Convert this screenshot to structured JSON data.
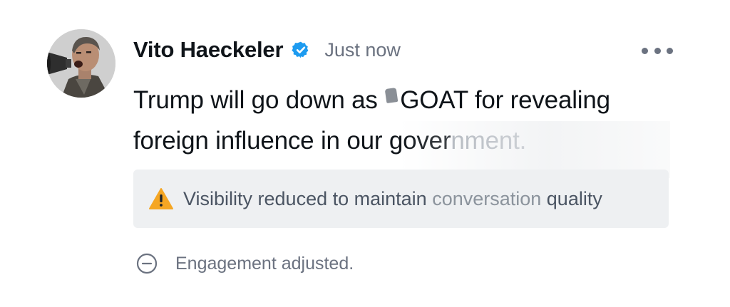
{
  "post": {
    "author": {
      "name": "Vito Haeckeler",
      "verified": true,
      "verified_color": "#1d9bf0"
    },
    "timestamp": "Just now",
    "more_icon": "more-horizontal-icon",
    "text": {
      "part1": "Trump will go down as ",
      "part2": "GOAT for revealing",
      "part3": "foreign influence in our gover",
      "part4": "nment."
    },
    "notice": {
      "icon": "warning-icon",
      "icon_color": "#f5a623",
      "text_a": "Visibility reduced to maintain ",
      "text_b": "conversation",
      "text_c": " quality"
    },
    "engagement": {
      "icon": "minus-circle-icon",
      "text": "Engagement adjusted."
    }
  }
}
